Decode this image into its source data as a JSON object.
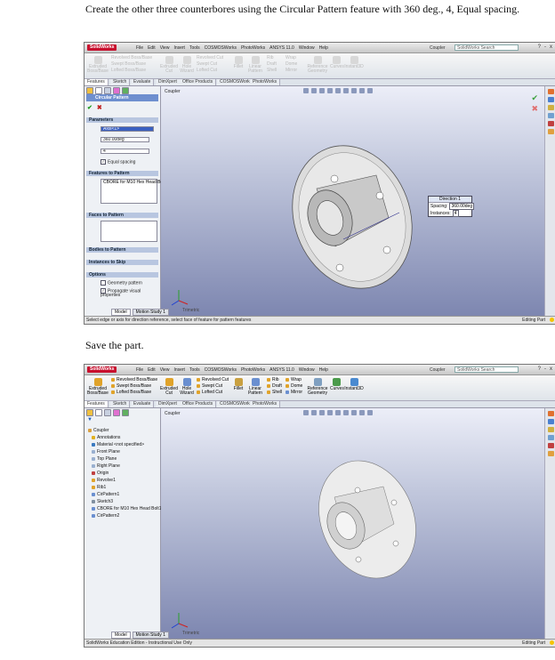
{
  "doc": {
    "instruction_1": "Create the other three counterbores using the Circular Pattern feature with 360 deg., 4, Equal spacing.",
    "instruction_2": "Save the part."
  },
  "app": {
    "logo": "SolidWorks",
    "menu": [
      "File",
      "Edit",
      "View",
      "Insert",
      "Tools",
      "COSMOSWorks",
      "PhotoWorks",
      "ANSYS 11.0",
      "Window",
      "Help"
    ],
    "document_name": "Coupler",
    "search_placeholder": "SolidWorks Search",
    "window_buttons": [
      "?",
      "-",
      "x"
    ]
  },
  "ribbon": {
    "large": [
      {
        "label": "Extruded Boss/Base",
        "color": "#e0a32a"
      },
      {
        "label": "Extruded Cut",
        "color": "#e0a32a"
      },
      {
        "label": "Hole Wizard",
        "color": "#6a8fd0"
      },
      {
        "label": "Fillet",
        "color": "#c9a040"
      },
      {
        "label": "Linear Pattern",
        "color": "#6a8fd0"
      },
      {
        "label": "Reference Geometry",
        "color": "#7f9fc0"
      },
      {
        "label": "Curves",
        "color": "#4a9a4a"
      },
      {
        "label": "Instant3D",
        "color": "#4a8ad0"
      }
    ],
    "small_col1": [
      "Revolved Boss/Base",
      "Swept Boss/Base",
      "Lofted Boss/Base"
    ],
    "small_col2": [
      "Revolved Cut",
      "Swept Cut",
      "Lofted Cut"
    ],
    "small_col3": [
      "Rib",
      "Draft",
      "Shell"
    ],
    "small_col4": [
      "Wrap",
      "Dome",
      "Mirror"
    ]
  },
  "tabs": [
    "Features",
    "Sketch",
    "Evaluate",
    "DimXpert",
    "Office Products",
    "COSMOSWorks",
    "PhotoWorks"
  ],
  "pattern_panel": {
    "title": "Circular Pattern",
    "ok": "✔",
    "cancel": "✖",
    "parameters": "Parameters",
    "axis": "Axis<1>",
    "angle": "360.00deg",
    "instances": "4",
    "equal_spacing": "Equal spacing",
    "features_to_pattern": "Features to Pattern",
    "feature_item": "CBORE for M10 Hex Head Bolt1",
    "faces_to_pattern": "Faces to Pattern",
    "bodies_to_pattern": "Bodies to Pattern",
    "instances_to_skip": "Instances to Skip",
    "options": "Options",
    "geometry_pattern": "Geometry pattern",
    "propagate": "Propagate visual properties"
  },
  "callout": {
    "title": "Direction 1",
    "spacing_label": "Spacing:",
    "spacing_value": "360.00deg",
    "instances_label": "Instances:",
    "instances_value": "4"
  },
  "tree": {
    "root": "Coupler",
    "items": [
      "Annotations",
      "Material <not specified>",
      "Front Plane",
      "Top Plane",
      "Right Plane",
      "Origin",
      "Revolve1",
      "Rib1",
      "CirPattern1",
      "Sketch3",
      "CBORE for M10 Hex Head Bolt1",
      "CirPattern2"
    ]
  },
  "bottom_tabs": [
    "Model",
    "Motion Study 1"
  ],
  "status1": {
    "left": "Select edge or axis for direction reference, select face of feature for pattern features",
    "right": "Editing Part"
  },
  "status2": {
    "left": "SolidWorks Education Edition - Instructional Use Only",
    "right": "Editing Part"
  },
  "triad_label": "Trimetric",
  "colors": {
    "viewport_top": "#eceef8",
    "viewport_bottom": "#7d86b0",
    "panel_header": "#6e8fcf"
  }
}
